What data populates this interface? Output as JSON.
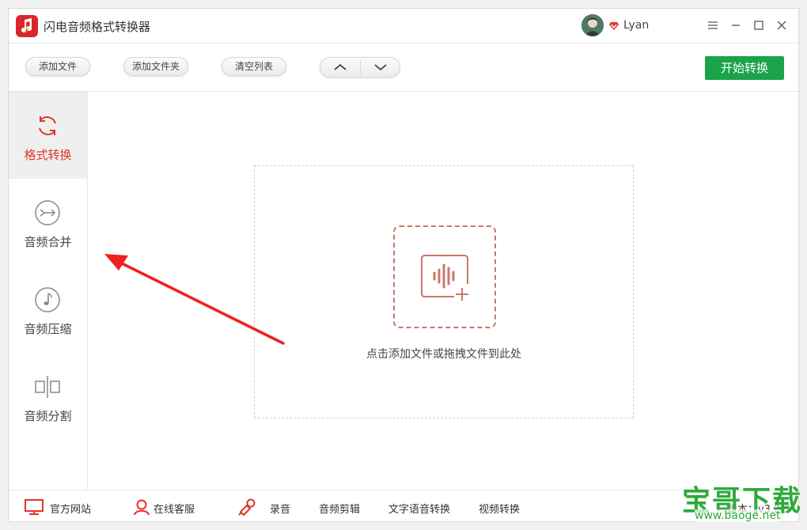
{
  "app": {
    "title": "闪电音频格式转换器",
    "brand_color": "#d8262b",
    "accent_color": "#e0352b",
    "start_color": "#1aa34a"
  },
  "user": {
    "name": "Lyan",
    "avatar_icon": "user-avatar",
    "vip_icon": "vip-diamond-icon"
  },
  "window_controls": {
    "menu_icon": "menu-icon",
    "minimize_icon": "minimize-icon",
    "maximize_icon": "maximize-icon",
    "close_icon": "close-icon"
  },
  "toolbar": {
    "add_file": "添加文件",
    "add_folder": "添加文件夹",
    "clear_list": "清空列表",
    "move_up_icon": "chevron-up-icon",
    "move_down_icon": "chevron-down-icon",
    "start": "开始转换"
  },
  "sidebar": {
    "items": [
      {
        "label": "格式转换",
        "icon": "refresh-icon",
        "active": true
      },
      {
        "label": "音频合并",
        "icon": "merge-icon",
        "active": false
      },
      {
        "label": "音频压缩",
        "icon": "music-note-icon",
        "active": false
      },
      {
        "label": "音频分割",
        "icon": "split-icon",
        "active": false
      }
    ]
  },
  "drop_zone": {
    "hint": "点击添加文件或拖拽文件到此处",
    "icon": "audio-add-icon"
  },
  "footer": {
    "official_site": "官方网站",
    "online_service": "在线客服",
    "record": "录音",
    "audio_edit": "音频剪辑",
    "tts": "文字语音转换",
    "video_convert": "视频转换",
    "version": "版本：v3.2.5"
  },
  "watermark": {
    "text": "宝哥下载",
    "url": "www.baoge.net"
  }
}
